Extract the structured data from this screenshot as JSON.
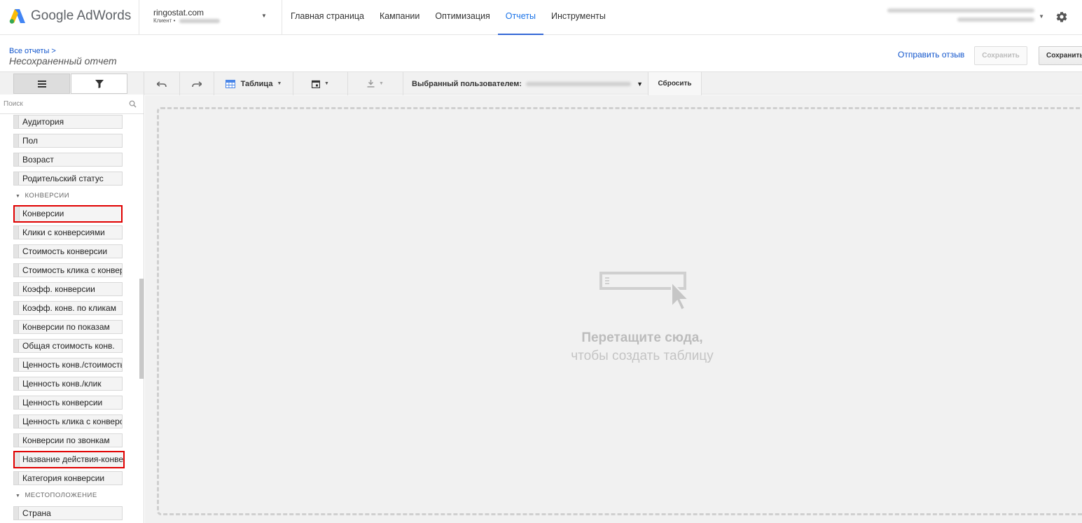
{
  "brand": {
    "name": "Google AdWords"
  },
  "account": {
    "name": "ringostat.com",
    "client_label": "Клиент"
  },
  "nav": {
    "items": [
      {
        "label": "Главная страница"
      },
      {
        "label": "Кампании"
      },
      {
        "label": "Оптимизация"
      },
      {
        "label": "Отчеты"
      },
      {
        "label": "Инструменты"
      }
    ],
    "active": "Отчеты"
  },
  "header": {
    "breadcrumb": "Все отчеты >",
    "title": "Несохраненный отчет",
    "feedback_label": "Отправить отзыв",
    "save_disabled_label": "Сохранить",
    "save_label": "Сохранить"
  },
  "toolbar": {
    "view_label": "Таблица",
    "date_label": "Выбранный пользователем:",
    "reset_label": "Сбросить"
  },
  "search": {
    "placeholder": "Поиск"
  },
  "list": {
    "top_items": [
      "Аудитория",
      "Пол",
      "Возраст",
      "Родительский статус"
    ],
    "section_conversions": "КОНВЕРСИИ",
    "conversion_items": [
      "Конверсии",
      "Клики с конверсиями",
      "Стоимость конверсии",
      "Стоимость клика с конвер",
      "Коэфф. конверсии",
      "Коэфф. конв. по кликам",
      "Конверсии по показам",
      "Общая стоимость конв.",
      "Ценность конв./стоимость",
      "Ценность конв./клик",
      "Ценность конверсии",
      "Ценность клика с конверс",
      "Конверсии по звонкам",
      "Название действия-конве",
      "Категория конверсии"
    ],
    "section_location": "МЕСТОПОЛОЖЕНИЕ",
    "location_items": [
      "Страна"
    ]
  },
  "canvas": {
    "drop_line1": "Перетащите сюда,",
    "drop_line2": "чтобы создать таблицу"
  },
  "colors": {
    "accent": "#3367d6",
    "link": "#1155cc",
    "highlight": "#e00000"
  }
}
